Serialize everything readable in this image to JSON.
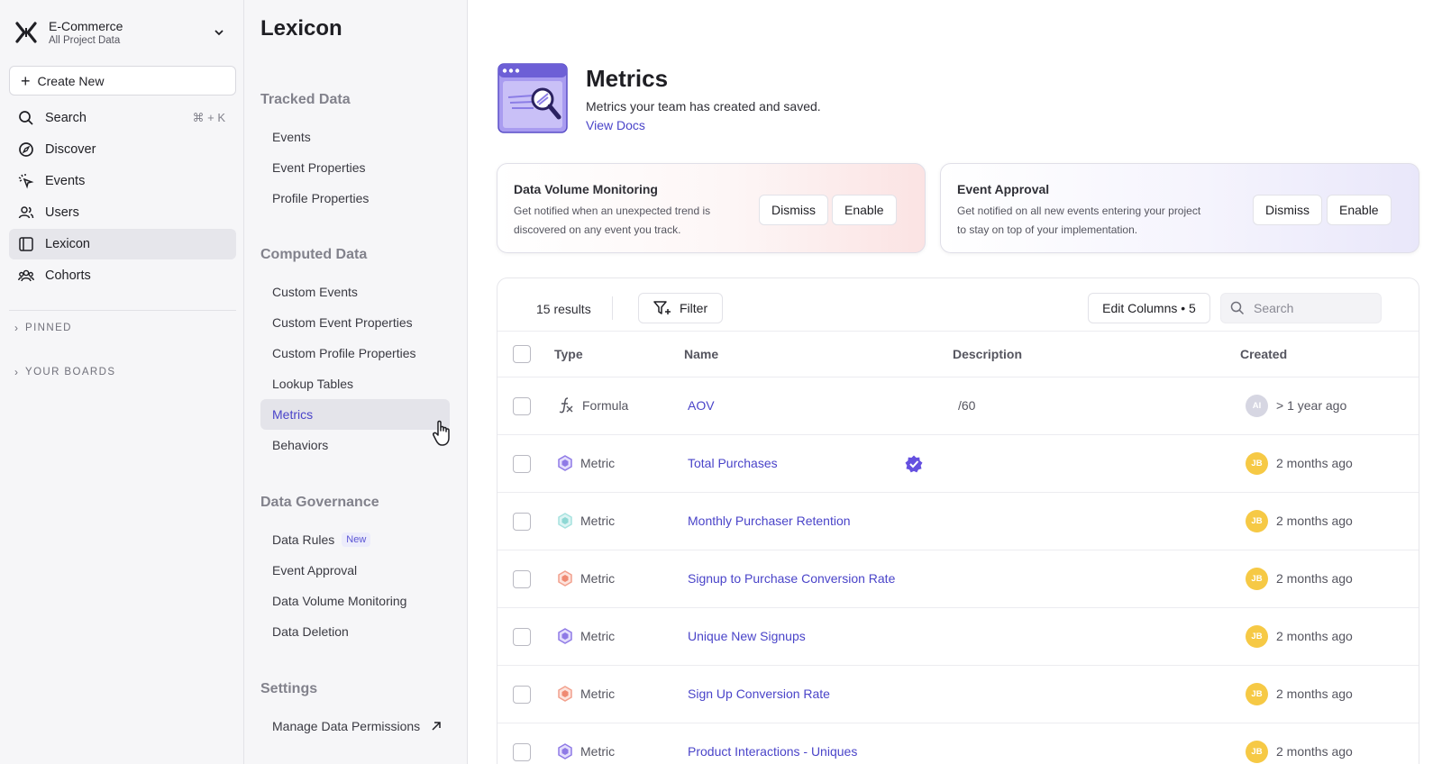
{
  "nav": {
    "project_name": "E-Commerce",
    "project_sub": "All Project Data",
    "create_new": "Create New",
    "search_label": "Search",
    "search_shortcut": "⌘ + K",
    "items": [
      {
        "label": "Discover",
        "icon": "compass-icon"
      },
      {
        "label": "Events",
        "icon": "events-icon"
      },
      {
        "label": "Users",
        "icon": "users-icon"
      },
      {
        "label": "Lexicon",
        "icon": "lexicon-icon",
        "active": true
      },
      {
        "label": "Cohorts",
        "icon": "cohorts-icon"
      }
    ],
    "pinned": "PINNED",
    "boards": "YOUR BOARDS"
  },
  "lexicon": {
    "title": "Lexicon",
    "sections": [
      {
        "heading": "Tracked Data",
        "items": [
          "Events",
          "Event Properties",
          "Profile Properties"
        ]
      },
      {
        "heading": "Computed Data",
        "items": [
          "Custom Events",
          "Custom Event Properties",
          "Custom Profile Properties",
          "Lookup Tables",
          "Metrics",
          "Behaviors"
        ]
      },
      {
        "heading": "Data Governance",
        "items": [
          "Data Rules",
          "Event Approval",
          "Data Volume Monitoring",
          "Data Deletion"
        ],
        "new_badge": "New"
      },
      {
        "heading": "Settings",
        "items": [
          "Manage Data Permissions"
        ]
      }
    ]
  },
  "header": {
    "title": "Metrics",
    "description": "Metrics your team has created and saved.",
    "link": "View Docs"
  },
  "cards": [
    {
      "title": "Data Volume Monitoring",
      "desc": "Get notified when an unexpected trend is discovered on any event you track.",
      "dismiss": "Dismiss",
      "enable": "Enable"
    },
    {
      "title": "Event Approval",
      "desc": "Get notified on all new events entering your project to stay on top of your implementation.",
      "dismiss": "Dismiss",
      "enable": "Enable"
    }
  ],
  "toolbar": {
    "results": "15 results",
    "filter": "Filter",
    "edit_columns": "Edit Columns • 5",
    "search_placeholder": "Search"
  },
  "table": {
    "columns": [
      "Type",
      "Name",
      "Description",
      "Created"
    ],
    "rows": [
      {
        "type": "Formula",
        "name": "AOV",
        "description": "/60",
        "avatar": "AI",
        "created": "> 1 year ago"
      },
      {
        "type": "Metric",
        "name": "Total Purchases",
        "description": "",
        "avatar": "JB",
        "created": "2 months ago",
        "verified": true
      },
      {
        "type": "Metric",
        "name": "Monthly Purchaser Retention",
        "description": "",
        "avatar": "JB",
        "created": "2 months ago"
      },
      {
        "type": "Metric",
        "name": "Signup to Purchase Conversion Rate",
        "description": "",
        "avatar": "JB",
        "created": "2 months ago"
      },
      {
        "type": "Metric",
        "name": "Unique New Signups",
        "description": "",
        "avatar": "JB",
        "created": "2 months ago"
      },
      {
        "type": "Metric",
        "name": "Sign Up Conversion Rate",
        "description": "",
        "avatar": "JB",
        "created": "2 months ago"
      },
      {
        "type": "Metric",
        "name": "Product Interactions - Uniques",
        "description": "",
        "avatar": "JB",
        "created": "2 months ago"
      }
    ]
  },
  "colors": {
    "accent": "#4a44c9",
    "metric_purple": "#8f7ae6",
    "metric_teal": "#8ed8d4",
    "metric_coral": "#ef8a72",
    "avatar_yellow": "#f6c945"
  }
}
